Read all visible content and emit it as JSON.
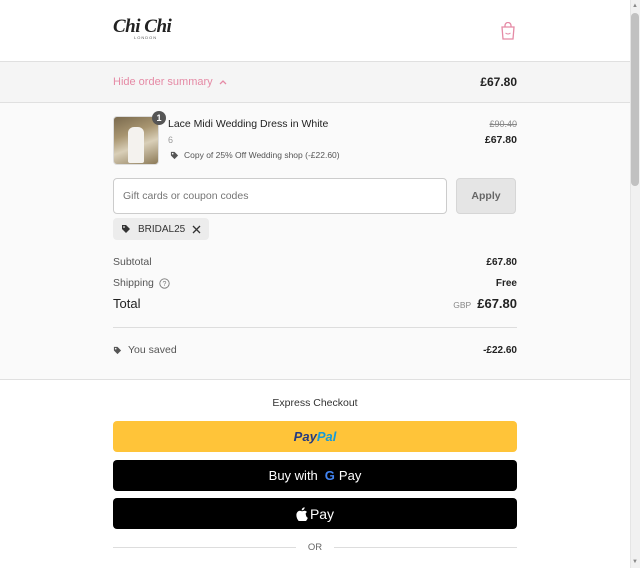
{
  "header": {
    "logo": "Chi Chi",
    "logo_sub": "LONDON"
  },
  "summary_bar": {
    "toggle_label": "Hide order summary",
    "total": "£67.80"
  },
  "item": {
    "quantity": "1",
    "title": "Lace Midi Wedding Dress in White",
    "variant": "6",
    "discount_label": "Copy of 25% Off Wedding shop (-£22.60)",
    "original_price": "£90.40",
    "price": "£67.80"
  },
  "coupon": {
    "placeholder": "Gift cards or coupon codes",
    "apply_label": "Apply",
    "applied_code": "BRIDAL25"
  },
  "totals": {
    "subtotal_label": "Subtotal",
    "subtotal": "£67.80",
    "shipping_label": "Shipping",
    "shipping": "Free",
    "total_label": "Total",
    "currency": "GBP",
    "total": "£67.80",
    "saved_label": "You saved",
    "saved": "-£22.60"
  },
  "express": {
    "title": "Express Checkout",
    "paypal_a": "Pay",
    "paypal_b": "Pal",
    "gpay_prefix": "Buy with",
    "gpay_g": "G",
    "gpay_pay": "Pay",
    "apay_pay": "Pay",
    "or_label": "OR"
  },
  "colors": {
    "accent": "#e58aa5",
    "paypal_yellow": "#ffc439"
  }
}
